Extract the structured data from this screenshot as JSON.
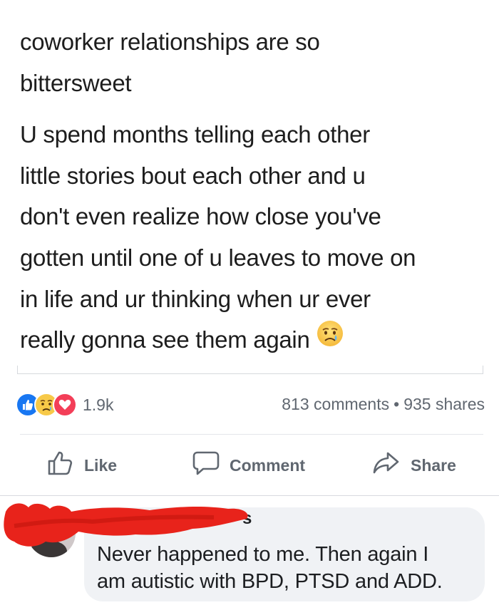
{
  "post": {
    "title_lines": [
      "coworker relationships are so",
      "bittersweet"
    ],
    "body_lines": [
      "U spend months telling each other",
      "little stories bout each other and u",
      "don't even realize how close you've",
      "gotten until one of u leaves to move on",
      "in life and ur thinking when ur ever",
      "really gonna see them again"
    ],
    "trailing_emoji": "crying-face-emoji"
  },
  "stats": {
    "reaction_icons": [
      "like-icon",
      "sad-icon",
      "love-icon"
    ],
    "reaction_count": "1.9k",
    "comments": "813 comments",
    "separator": "•",
    "shares": "935 shares"
  },
  "actions": {
    "like": "Like",
    "comment": "Comment",
    "share": "Share"
  },
  "comment": {
    "author": "s",
    "lines": [
      "Never happened to me. Then again I",
      "am autistic with BPD, PTSD and ADD."
    ],
    "redaction_color": "#e8231b"
  },
  "colors": {
    "like_blue": "#1877f2",
    "love_red": "#f33e58",
    "sad_yellow": "#f7c948",
    "text_gray": "#606770"
  }
}
